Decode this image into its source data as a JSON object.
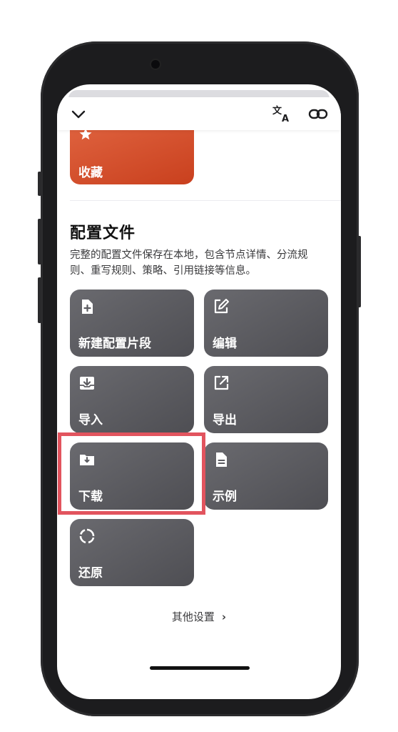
{
  "favorite": {
    "label": "收藏"
  },
  "section": {
    "title": "配置文件",
    "description": "完整的配置文件保存在本地，包含节点详情、分流规则、重写规则、策略、引用链接等信息。"
  },
  "tiles": [
    {
      "label": "新建配置片段",
      "icon": "new-file-icon"
    },
    {
      "label": "编辑",
      "icon": "edit-icon"
    },
    {
      "label": "导入",
      "icon": "import-icon"
    },
    {
      "label": "导出",
      "icon": "export-icon"
    },
    {
      "label": "下载",
      "icon": "download-folder-icon"
    },
    {
      "label": "示例",
      "icon": "document-icon"
    },
    {
      "label": "还原",
      "icon": "restore-icon"
    }
  ],
  "more": {
    "label": "其他设置"
  },
  "colors": {
    "favorite_card": "#d4502c",
    "tile": "#5c5c61",
    "highlight": "#e2545e"
  }
}
